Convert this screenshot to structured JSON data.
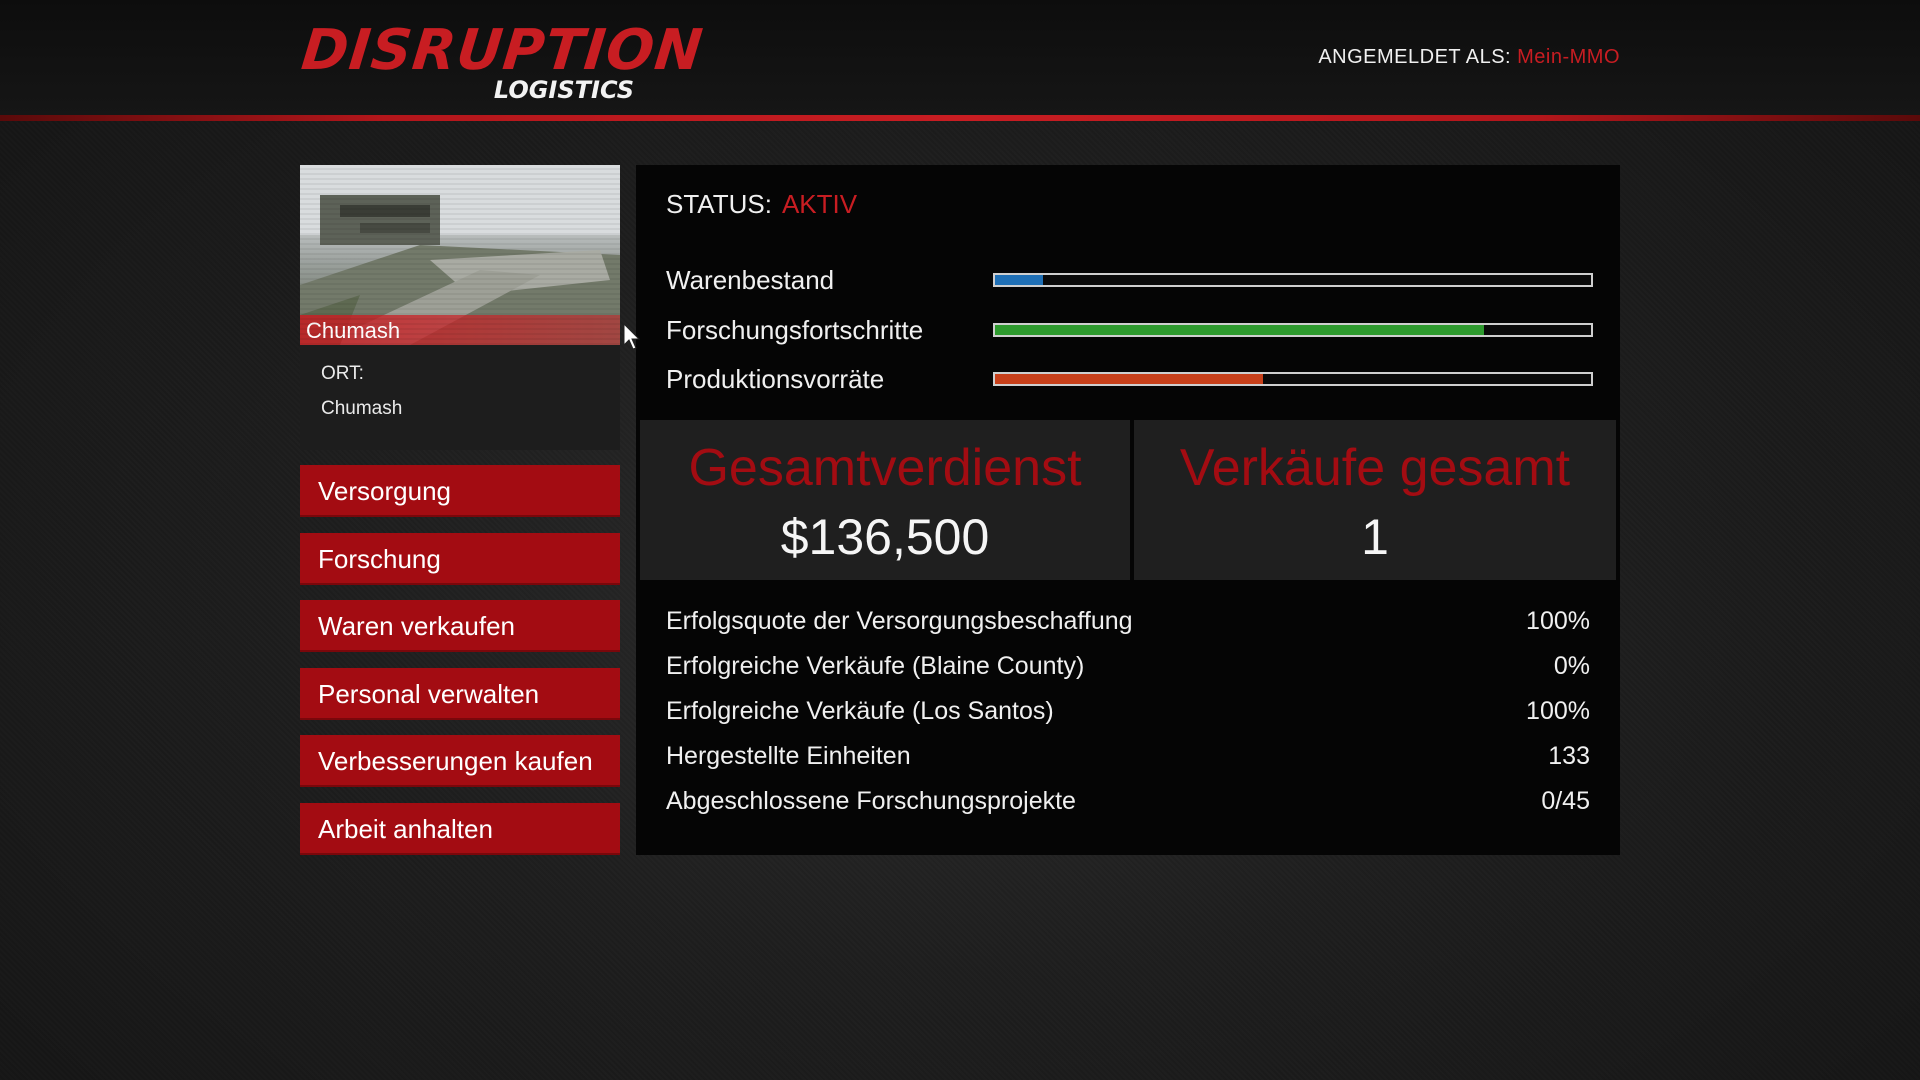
{
  "header": {
    "logo_main": "DISRUPTION",
    "logo_sub": "LOGISTICS",
    "login_label": "ANGEMELDET ALS:",
    "login_user": "Mein-MMO"
  },
  "location": {
    "name": "Chumash",
    "label": "ORT:",
    "value": "Chumash"
  },
  "menu": [
    {
      "label": "Versorgung"
    },
    {
      "label": "Forschung"
    },
    {
      "label": "Waren verkaufen"
    },
    {
      "label": "Personal verwalten"
    },
    {
      "label": "Verbesserungen kaufen"
    },
    {
      "label": "Arbeit anhalten"
    }
  ],
  "status": {
    "label": "STATUS:",
    "value": "AKTIV"
  },
  "bars": [
    {
      "label": "Warenbestand",
      "fill_fraction": 0.08,
      "color": "#1f6fb5"
    },
    {
      "label": "Forschungsfortschritte",
      "fill_fraction": 0.82,
      "color": "#2e9a2e"
    },
    {
      "label": "Produktionsvorräte",
      "fill_fraction": 0.45,
      "color": "#c8401a"
    }
  ],
  "totals": {
    "earnings_title": "Gesamtverdienst",
    "earnings_value": "$136,500",
    "sales_title": "Verkäufe gesamt",
    "sales_value": "1"
  },
  "stats": [
    {
      "label": "Erfolgsquote der Versorgungsbeschaffung",
      "value": "100%"
    },
    {
      "label": "Erfolgreiche Verkäufe (Blaine County)",
      "value": "0%"
    },
    {
      "label": "Erfolgreiche Verkäufe (Los Santos)",
      "value": "100%"
    },
    {
      "label": "Hergestellte Einheiten",
      "value": "133"
    },
    {
      "label": "Abgeschlossene Forschungsprojekte",
      "value": "0/45"
    }
  ],
  "colors": {
    "accent": "#c81d22",
    "button": "#a30c12"
  }
}
